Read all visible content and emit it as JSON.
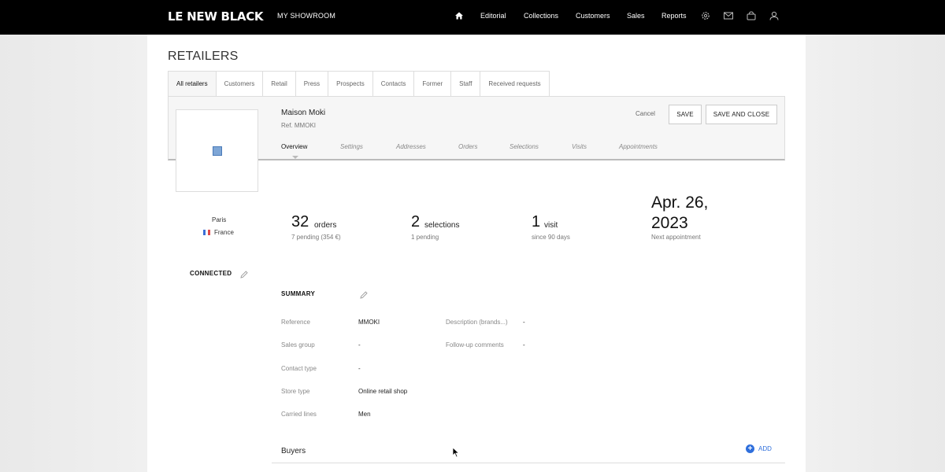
{
  "brand": {
    "logo": "LE NEW BLACK",
    "showroom": "MY SHOWROOM"
  },
  "nav": {
    "items": [
      "Editorial",
      "Collections",
      "Customers",
      "Sales",
      "Reports"
    ]
  },
  "page": {
    "title": "RETAILERS"
  },
  "tabs": [
    "All retailers",
    "Customers",
    "Retail",
    "Press",
    "Prospects",
    "Contacts",
    "Former",
    "Staff",
    "Received requests"
  ],
  "retailer": {
    "name": "Maison Moki",
    "ref": "Ref. MMOKI",
    "city": "Paris",
    "country": "France",
    "status": "CONNECTED"
  },
  "actions": {
    "cancel": "Cancel",
    "save": "SAVE",
    "save_close": "SAVE AND CLOSE"
  },
  "subtabs": [
    "Overview",
    "Settings",
    "Addresses",
    "Orders",
    "Selections",
    "Visits",
    "Appointments"
  ],
  "stats": {
    "orders": {
      "num": "32",
      "word": "orders",
      "sub": "7 pending (354 €)"
    },
    "selections": {
      "num": "2",
      "word": "selections",
      "sub": "1 pending"
    },
    "visits": {
      "num": "1",
      "word": "visit",
      "sub": "since 90 days"
    },
    "appointment": {
      "date": "Apr. 26, 2023",
      "label": "Next appointment"
    }
  },
  "summary": {
    "title": "SUMMARY",
    "reference_label": "Reference",
    "reference_value": "MMOKI",
    "sales_group_label": "Sales group",
    "sales_group_value": "-",
    "contact_type_label": "Contact type",
    "contact_type_value": "-",
    "store_type_label": "Store type",
    "store_type_value": "Online retail shop",
    "carried_lines_label": "Carried lines",
    "carried_lines_value": "Men",
    "description_label": "Description (brands...)",
    "description_value": "-",
    "followup_label": "Follow-up comments",
    "followup_value": "-"
  },
  "buyers": {
    "title": "Buyers",
    "add": "ADD"
  },
  "colors": {
    "accent": "#2f6fdc",
    "topbar": "#000000"
  }
}
